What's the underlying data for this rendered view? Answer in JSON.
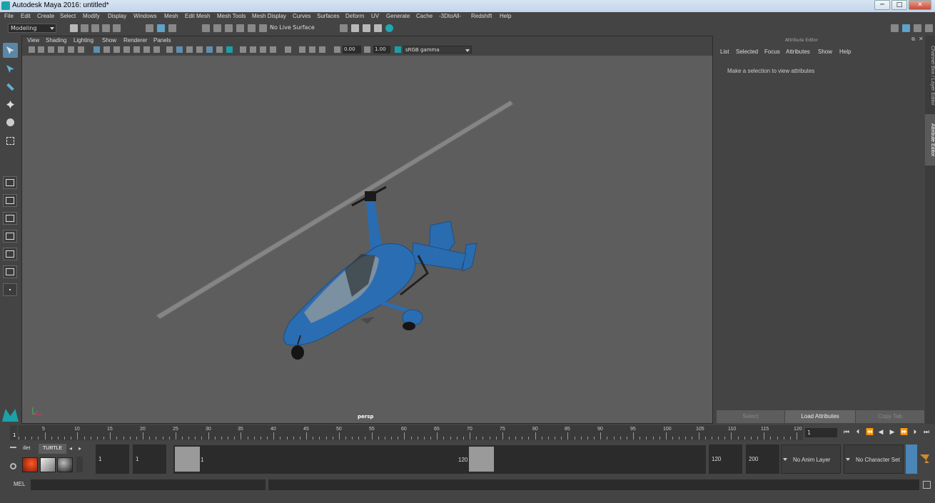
{
  "window": {
    "title": "Autodesk Maya 2016: untitled*",
    "minimize": "─",
    "maximize": "□",
    "close": "✕"
  },
  "menubar": [
    "File",
    "Edit",
    "Create",
    "Select",
    "Modify",
    "Display",
    "Windows",
    "Mesh",
    "Edit Mesh",
    "Mesh Tools",
    "Mesh Display",
    "Curves",
    "Surfaces",
    "Deform",
    "UV",
    "Generate",
    "Cache",
    "-3DtoAll-",
    "Redshift",
    "Help"
  ],
  "shelf": {
    "menu_set": "Modeling",
    "live_surface": "No Live Surface"
  },
  "viewport": {
    "menus": [
      "View",
      "Shading",
      "Lighting",
      "Show",
      "Renderer",
      "Panels"
    ],
    "exposure": "0.00",
    "gamma": "1.00",
    "color_space": "sRGB gamma",
    "camera_label": "persp"
  },
  "attribute_editor": {
    "title": "Attribute Editor",
    "menus": [
      "List",
      "Selected",
      "Focus",
      "Attributes",
      "Show",
      "Help"
    ],
    "message": "Make a selection to view attributes",
    "buttons": [
      "Select",
      "Load Attributes",
      "Copy Tab"
    ]
  },
  "side_tabs": [
    "Channel Box / Layer Editor",
    "Attribute Editor"
  ],
  "timeline": {
    "ticks": [
      "5",
      "10",
      "15",
      "20",
      "25",
      "30",
      "35",
      "40",
      "45",
      "50",
      "55",
      "60",
      "65",
      "70",
      "75",
      "80",
      "85",
      "90",
      "95",
      "100",
      "105",
      "110",
      "115",
      "120"
    ],
    "current_frame_marker": "1",
    "current_frame": "1",
    "playback_glyphs": [
      "⏮",
      "⏴",
      "⏪",
      "◀",
      "▶",
      "⏩",
      "⏵",
      "⏭"
    ]
  },
  "shelf_tabs": {
    "partial": "illet",
    "active": "TURTLE"
  },
  "range": {
    "start": "1",
    "playback_start": "1",
    "slider_start": "1",
    "slider_end": "120",
    "playback_end": "120",
    "end": "200",
    "anim_layer": "No Anim Layer",
    "character_set": "No Character Set"
  },
  "command_line": {
    "label": "MEL"
  }
}
